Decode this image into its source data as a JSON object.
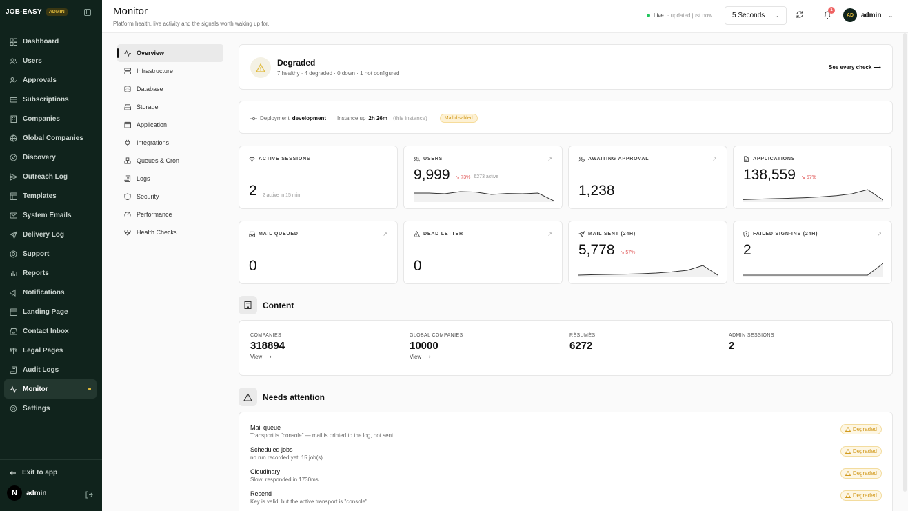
{
  "brand": {
    "name": "JOB-EASY",
    "badge": "ADMIN"
  },
  "sidebar": {
    "items": [
      {
        "label": "Dashboard",
        "icon": "grid-icon"
      },
      {
        "label": "Users",
        "icon": "users-icon"
      },
      {
        "label": "Approvals",
        "icon": "user-check-icon"
      },
      {
        "label": "Subscriptions",
        "icon": "credit-card-icon"
      },
      {
        "label": "Companies",
        "icon": "building-icon"
      },
      {
        "label": "Global Companies",
        "icon": "globe-icon"
      },
      {
        "label": "Discovery",
        "icon": "compass-icon"
      },
      {
        "label": "Outreach Log",
        "icon": "outreach-icon"
      },
      {
        "label": "Templates",
        "icon": "template-icon"
      },
      {
        "label": "System Emails",
        "icon": "mail-icon"
      },
      {
        "label": "Delivery Log",
        "icon": "send-icon"
      },
      {
        "label": "Support",
        "icon": "lifebuoy-icon"
      },
      {
        "label": "Reports",
        "icon": "bar-chart-icon"
      },
      {
        "label": "Notifications",
        "icon": "megaphone-icon"
      },
      {
        "label": "Landing Page",
        "icon": "layout-icon"
      },
      {
        "label": "Contact Inbox",
        "icon": "inbox-icon"
      },
      {
        "label": "Legal Pages",
        "icon": "scale-icon"
      },
      {
        "label": "Audit Logs",
        "icon": "scroll-icon"
      },
      {
        "label": "Monitor",
        "icon": "activity-icon",
        "active": true
      },
      {
        "label": "Settings",
        "icon": "gear-icon"
      }
    ],
    "exit_label": "Exit to app",
    "user": {
      "avatar": "N",
      "name": "admin"
    }
  },
  "header": {
    "title": "Monitor",
    "subtitle": "Platform health, live activity and the signals worth waking up for.",
    "live_label": "Live",
    "live_updated": "· updated just now",
    "interval": "5 Seconds",
    "notification_count": "1",
    "user_initials": "AD",
    "user_name": "admin"
  },
  "subnav": {
    "items": [
      {
        "label": "Overview",
        "icon": "activity-icon",
        "active": true
      },
      {
        "label": "Infrastructure",
        "icon": "server-icon"
      },
      {
        "label": "Database",
        "icon": "database-icon"
      },
      {
        "label": "Storage",
        "icon": "hard-drive-icon"
      },
      {
        "label": "Application",
        "icon": "app-window-icon"
      },
      {
        "label": "Integrations",
        "icon": "plug-icon"
      },
      {
        "label": "Queues & Cron",
        "icon": "boxes-icon"
      },
      {
        "label": "Logs",
        "icon": "logs-icon"
      },
      {
        "label": "Security",
        "icon": "shield-icon"
      },
      {
        "label": "Performance",
        "icon": "gauge-icon"
      },
      {
        "label": "Health Checks",
        "icon": "heart-pulse-icon"
      }
    ]
  },
  "status": {
    "title": "Degraded",
    "summary": "7 healthy · 4 degraded · 0 down · 1 not configured",
    "link": "See every check ⟶"
  },
  "deployment": {
    "label": "Deployment",
    "value": "development",
    "uptime_label": "Instance up",
    "uptime_value": "2h 26m",
    "uptime_note": "(this instance)",
    "mail_chip": "Mail disabled"
  },
  "metrics": [
    {
      "label": "ACTIVE SESSIONS",
      "icon": "wifi-icon",
      "value": "2",
      "note": "2 active in 15 min",
      "change": "",
      "arrow": false,
      "spark": []
    },
    {
      "label": "USERS",
      "icon": "users-icon",
      "value": "9,999",
      "change": "↘ 73%",
      "note": "6273 active",
      "arrow": true,
      "spark": [
        0.55,
        0.55,
        0.5,
        0.65,
        0.62,
        0.45,
        0.52,
        0.5,
        0.55,
        0.0
      ]
    },
    {
      "label": "AWAITING APPROVAL",
      "icon": "user-clock-icon",
      "value": "1,238",
      "note": "",
      "change": "",
      "arrow": true,
      "spark": []
    },
    {
      "label": "APPLICATIONS",
      "icon": "file-icon",
      "value": "138,559",
      "change": "↘ 57%",
      "note": "",
      "arrow": false,
      "spark": [
        0.08,
        0.12,
        0.15,
        0.18,
        0.22,
        0.28,
        0.36,
        0.5,
        0.8,
        0.05
      ]
    },
    {
      "label": "MAIL QUEUED",
      "icon": "inbox-icon",
      "value": "0",
      "note": "",
      "change": "",
      "arrow": true,
      "spark": []
    },
    {
      "label": "DEAD LETTER",
      "icon": "alert-triangle-icon",
      "value": "0",
      "note": "",
      "change": "",
      "arrow": true,
      "spark": []
    },
    {
      "label": "MAIL SENT (24H)",
      "icon": "send-icon",
      "value": "5,778",
      "change": "↘ 57%",
      "note": "",
      "arrow": false,
      "spark": [
        0.05,
        0.08,
        0.1,
        0.12,
        0.15,
        0.2,
        0.28,
        0.4,
        0.75,
        0.02
      ]
    },
    {
      "label": "FAILED SIGN-INS (24H)",
      "icon": "shield-alert-icon",
      "value": "2",
      "note": "",
      "change": "",
      "arrow": true,
      "spark": [
        0.05,
        0.05,
        0.05,
        0.05,
        0.05,
        0.05,
        0.05,
        0.05,
        0.05,
        0.9
      ]
    }
  ],
  "content": {
    "title": "Content",
    "items": [
      {
        "label": "COMPANIES",
        "value": "318894",
        "link": "View ⟶"
      },
      {
        "label": "GLOBAL COMPANIES",
        "value": "10000",
        "link": "View ⟶"
      },
      {
        "label": "RÉSUMÉS",
        "value": "6272",
        "link": ""
      },
      {
        "label": "ADMIN SESSIONS",
        "value": "2",
        "link": ""
      }
    ]
  },
  "attention": {
    "title": "Needs attention",
    "items": [
      {
        "name": "Mail queue",
        "desc": "Transport is \"console\" — mail is printed to the log, not sent",
        "badge": "Degraded"
      },
      {
        "name": "Scheduled jobs",
        "desc": "no run recorded yet: 15 job(s)",
        "badge": "Degraded"
      },
      {
        "name": "Cloudinary",
        "desc": "Slow: responded in 1730ms",
        "badge": "Degraded"
      },
      {
        "name": "Resend",
        "desc": "Key is valid, but the active transport is \"console\"",
        "badge": "Degraded"
      }
    ]
  },
  "colors": {
    "sidebar_bg": "#10231c",
    "accent": "#e0b93a",
    "live": "#22c55e",
    "negative": "#e05656",
    "warning": "#d29a1e"
  }
}
